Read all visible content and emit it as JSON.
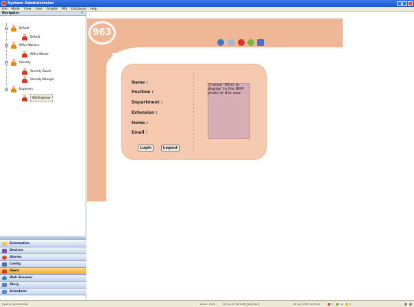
{
  "window": {
    "title": "System Administrator"
  },
  "menu": [
    "File",
    "Mode",
    "View",
    "User",
    "Graphs",
    "IMS",
    "Database",
    "Help"
  ],
  "navigator": {
    "title": "Navigator",
    "groups": [
      {
        "label": "Default",
        "users": [
          "Default"
        ]
      },
      {
        "label": "Office Workers",
        "users": [
          "Office Worker"
        ]
      },
      {
        "label": "Security",
        "users": [
          "Security Guard",
          "Security Manager"
        ]
      },
      {
        "label": "Engineers",
        "users": [
          "963 Engineer"
        ]
      }
    ],
    "selected_user": "963 Engineer"
  },
  "panes": [
    {
      "label": "Schematics",
      "icon": "folder-icon",
      "color": "#f2c94c"
    },
    {
      "label": "Devices",
      "icon": "devices-icon",
      "color": "#7a55a8"
    },
    {
      "label": "Alarms",
      "icon": "alarm-bell-icon",
      "color": "#d64a2a"
    },
    {
      "label": "Config",
      "icon": "config-icon",
      "color": "#4d6fb0"
    },
    {
      "label": "Users",
      "icon": "users-icon",
      "color": "#d7381f",
      "active": true
    },
    {
      "label": "Web Browser",
      "icon": "globe-icon",
      "color": "#2f7fcf"
    },
    {
      "label": "Diary",
      "icon": "diary-icon",
      "color": "#5f7fb8"
    },
    {
      "label": "Scheduler",
      "icon": "calendar-icon",
      "color": "#4d8fd0"
    }
  ],
  "logo": {
    "text": "963"
  },
  "user_card": {
    "fields": [
      "Name :",
      "Position :",
      "Department :",
      "Extension :",
      "Home :",
      "Email :"
    ],
    "photo_placeholder": "Change 'What to display' to the BMP photo of this user",
    "login_label": "Login",
    "logout_label": "Logout"
  },
  "toolbar_icons": [
    "help-icon",
    "search-icon",
    "cancel-icon",
    "refresh-icon",
    "export-icon"
  ],
  "statusbar": {
    "left": "System Administrator",
    "zoom": "Zoom: 100%",
    "server": "963 v1.00 [SECURE][Engineer]",
    "datetime": "26 July 2008 10:09:48",
    "counters": [
      "0",
      "11",
      "0"
    ]
  },
  "colors": {
    "accent": "#f0b796",
    "card": "#f6c9b1",
    "active_pane": "#f5a928"
  }
}
